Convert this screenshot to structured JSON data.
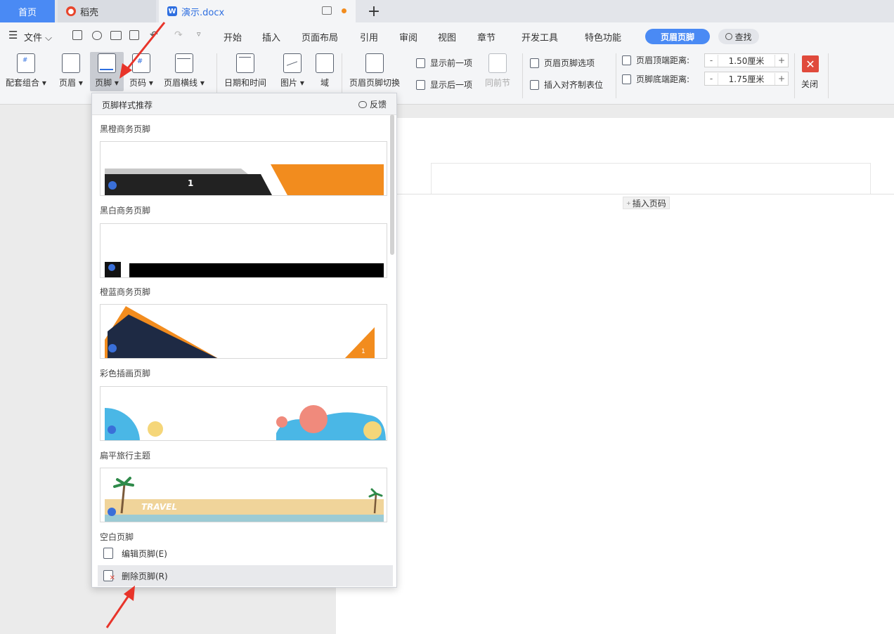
{
  "tabs": {
    "home": "首页",
    "daoke": "稻壳",
    "doc": "演示.docx",
    "add": "+"
  },
  "menu": {
    "hamburger": "☰",
    "file": "文件",
    "items": [
      "开始",
      "插入",
      "页面布局",
      "引用",
      "审阅",
      "视图",
      "章节",
      "开发工具",
      "特色功能"
    ],
    "active_tab": "页眉页脚",
    "search": "查找"
  },
  "ribbon": {
    "combo": "配套组合",
    "header": "页眉",
    "footer": "页脚",
    "page_number": "页码",
    "header_line": "页眉横线",
    "date_time": "日期和时间",
    "picture": "图片",
    "field": "域",
    "switch": "页眉页脚切换",
    "show_prev": "显示前一项",
    "show_next": "显示后一项",
    "same_as_prev": "同前节",
    "options": "页眉页脚选项",
    "insert_align_tab": "插入对齐制表位",
    "header_top_label": "页眉顶端距离:",
    "header_top_value": "1.50厘米",
    "footer_bottom_label": "页脚底端距离:",
    "footer_bottom_value": "1.75厘米",
    "close": "关闭",
    "minus": "-",
    "plus": "+",
    "close_glyph": "✕"
  },
  "document": {
    "insert_page_number": "插入页码"
  },
  "dropdown": {
    "title": "页脚样式推荐",
    "feedback": "反馈",
    "styles": [
      {
        "label": "黑橙商务页脚",
        "page_number": "1"
      },
      {
        "label": "黑白商务页脚"
      },
      {
        "label": "橙蓝商务页脚",
        "page_number": "1"
      },
      {
        "label": "彩色插画页脚"
      },
      {
        "label": "扁平旅行主题",
        "text": "TRAVEL"
      }
    ],
    "blank": "空白页脚",
    "edit": "编辑页脚(E)",
    "delete": "删除页脚(R)"
  },
  "colors": {
    "accent": "#4a8af4",
    "orange": "#f28c1e",
    "arrow": "#e8342a",
    "close": "#e04a3c"
  }
}
